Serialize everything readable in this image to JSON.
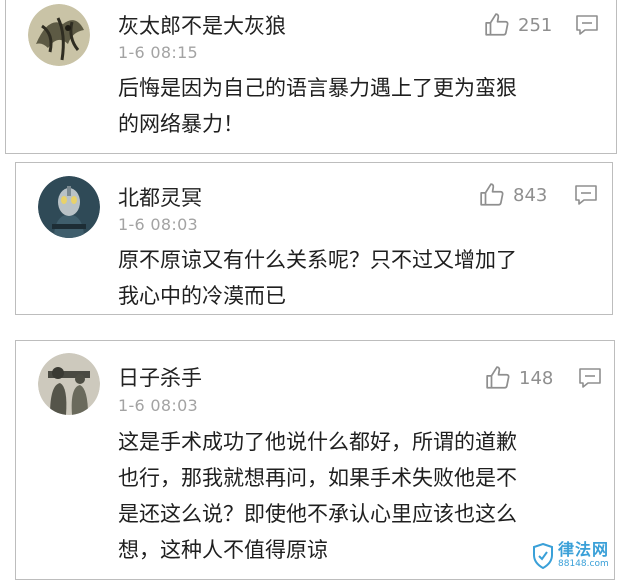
{
  "comments": [
    {
      "user": "灰太郎不是大灰狼",
      "time": "1-6 08:15",
      "likes": "251",
      "lines": [
        "后悔是因为自己的语言暴力遇上了更为蛮狠",
        "的网络暴力！"
      ]
    },
    {
      "user": "北都灵冥",
      "time": "1-6 08:03",
      "likes": "843",
      "lines": [
        "原不原谅又有什么关系呢？只不过又增加了",
        "我心中的冷漠而已"
      ]
    },
    {
      "user": "日子杀手",
      "time": "1-6 08:03",
      "likes": "148",
      "lines": [
        "这是手术成功了他说什么都好，所谓的道歉",
        "也行，那我就想再问，如果手术失败他是不",
        "是还这么说？即使他不承认心里应该也这么",
        "想，这种人不值得原谅"
      ]
    }
  ],
  "watermark": {
    "title": "律法网",
    "url": "88148.com"
  },
  "icons": {
    "like": "thumbs-up-icon",
    "reply": "comment-icon"
  },
  "colors": {
    "meta_gray": "#a3a3a3",
    "icon_gray": "#8f8f8f",
    "watermark_blue": "#3aa0d8"
  }
}
